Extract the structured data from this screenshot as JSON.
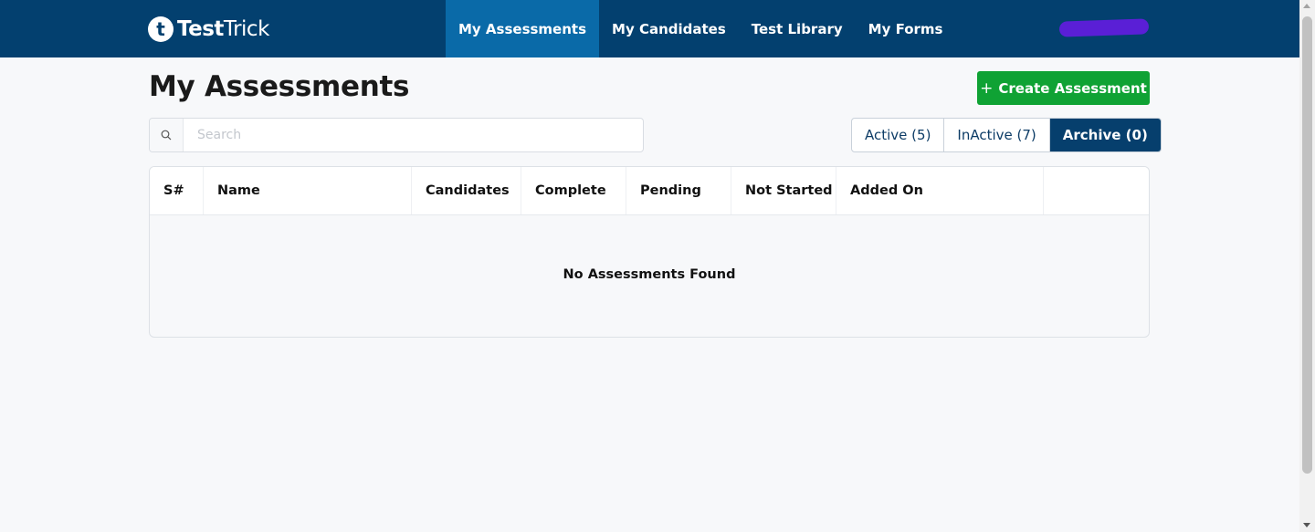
{
  "brand": {
    "mark": "t",
    "name_bold": "Test",
    "name_light": "Trick"
  },
  "nav": {
    "items": [
      {
        "label": "My Assessments",
        "active": true
      },
      {
        "label": "My Candidates",
        "active": false
      },
      {
        "label": "Test Library",
        "active": false
      },
      {
        "label": "My Forms",
        "active": false
      }
    ]
  },
  "page": {
    "title": "My Assessments",
    "create_label": "Create Assessment",
    "create_icon": "+"
  },
  "search": {
    "placeholder": "Search",
    "value": ""
  },
  "filters": [
    {
      "label": "Active (5)",
      "active": false
    },
    {
      "label": "InActive (7)",
      "active": false
    },
    {
      "label": "Archive (0)",
      "active": true
    }
  ],
  "table": {
    "columns": [
      "S#",
      "Name",
      "Candidates",
      "Complete",
      "Pending",
      "Not Started",
      "Added On",
      ""
    ],
    "empty_message": "No Assessments Found"
  },
  "colors": {
    "topbar": "#03406f",
    "nav_active": "#0a6aa8",
    "create_button": "#0fa234",
    "filter_active": "#063f6d"
  }
}
